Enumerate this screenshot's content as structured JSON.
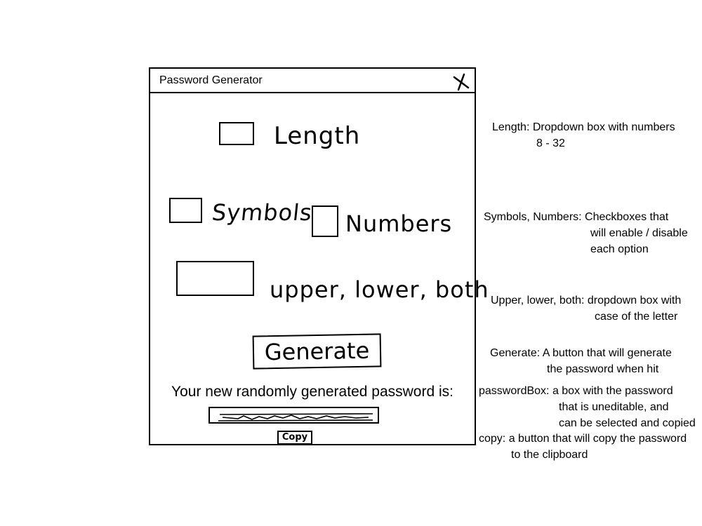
{
  "window": {
    "title": "Password Generator"
  },
  "controls": {
    "length_label": "Length",
    "symbols_label": "Symbols",
    "numbers_label": "Numbers",
    "case_label": "upper, lower, both",
    "generate_label": "Generate",
    "result_label": "Your new randomly generated password is:",
    "copy_label": "Copy"
  },
  "annotations": {
    "length": [
      "Length: Dropdown box with numbers",
      "8 - 32"
    ],
    "symbols_numbers": [
      "Symbols, Numbers: Checkboxes that",
      "will enable / disable",
      "each option"
    ],
    "case": [
      "Upper, lower, both: dropdown box with",
      "case of the letter"
    ],
    "generate": [
      "Generate: A button that will generate",
      "the password when hit"
    ],
    "password_box": [
      "passwordBox: a box with the password",
      "that is uneditable, and",
      "can be selected and copied"
    ],
    "copy": [
      "copy: a button that will copy the password",
      "to the clipboard"
    ]
  },
  "icons": {
    "close": "close-icon"
  }
}
